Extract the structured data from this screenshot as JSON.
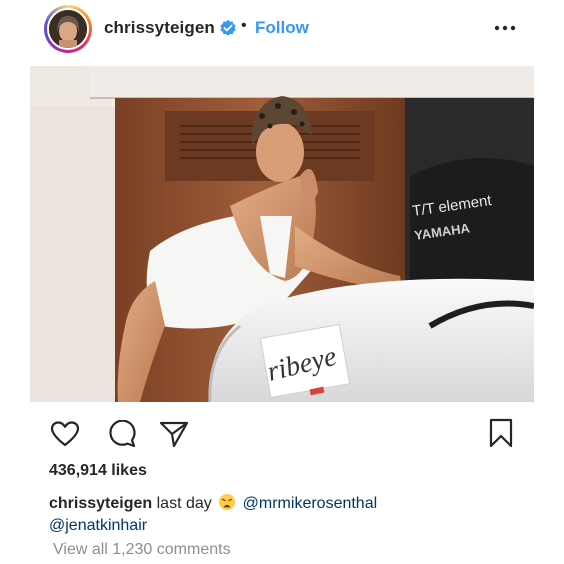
{
  "post": {
    "username": "chrissyteigen",
    "separator": "•",
    "follow_label": "Follow",
    "more_icon": "more-options-icon",
    "photo_text": {
      "engine_model": "T/T element",
      "engine_brand": "YAMAHA",
      "boat_name": "ribeye"
    },
    "likes": "436,914 likes",
    "caption": {
      "user": "chrissyteigen",
      "text": "last day",
      "emoji": "weary-face",
      "mention1": "@mrmikerosenthal",
      "mention2": "@jenatkinhair"
    },
    "view_comments": "View all 1,230 comments"
  },
  "icons": [
    "heart-icon",
    "comment-icon",
    "share-icon",
    "bookmark-icon",
    "verified-badge-icon"
  ],
  "colors": {
    "accent": "#3897f0",
    "verified": "#3897f0",
    "text": "#262626",
    "muted": "#8e8e8e",
    "mention": "#003569"
  }
}
